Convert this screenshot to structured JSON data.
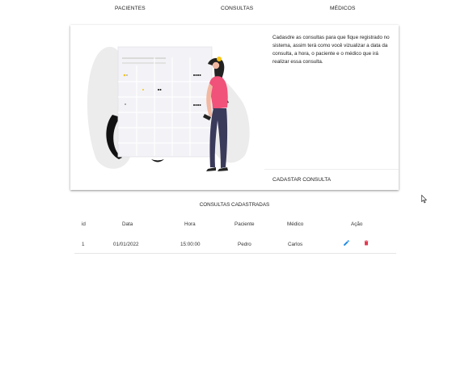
{
  "nav": {
    "items": [
      {
        "label": "PACIENTES"
      },
      {
        "label": "CONSULTAS"
      },
      {
        "label": "MÉDICOS"
      }
    ]
  },
  "card": {
    "description": "Cadasdre as consultas para que fique registrado no sistema, assim terá como você vizualizar a data da consulta, a hora, o paciente e o médico que irá realizar essa consulta.",
    "action_label": "CADASTAR CONSULTA"
  },
  "consultas": {
    "title": "CONSULTAS CADASTRADAS",
    "columns": [
      "id",
      "Data",
      "Hora",
      "Paciente",
      "Médico",
      "Ação"
    ],
    "rows": [
      {
        "id": "1",
        "data": "01/01/2022",
        "hora": "15:00:00",
        "paciente": "Pedro",
        "medico": "Carlos"
      }
    ]
  },
  "colors": {
    "edit": "#1e88e5",
    "delete": "#e53950",
    "accent_figure": "#f0527a",
    "accent_yellow": "#f5c518"
  },
  "icons": {
    "edit": "pencil-icon",
    "delete": "trash-icon",
    "cursor": "mouse-pointer-icon"
  }
}
